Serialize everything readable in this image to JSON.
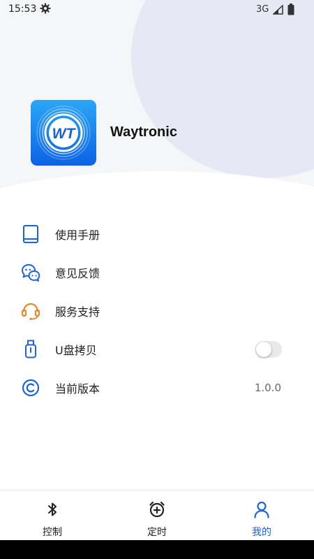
{
  "status_bar": {
    "time": "15:53",
    "network": "3G",
    "gear_icon": "gear-icon",
    "signal_icon": "signal-icon",
    "battery_icon": "battery-icon"
  },
  "app": {
    "name": "Waytronic",
    "logo_text": "WT"
  },
  "menu": {
    "items": [
      {
        "label": "使用手册",
        "icon": "book-icon",
        "color": "#1e63d6"
      },
      {
        "label": "意见反馈",
        "icon": "chat-bubbles-icon",
        "color": "#1e63d6"
      },
      {
        "label": "服务支持",
        "icon": "headset-icon",
        "color": "#e8892d"
      },
      {
        "label": "U盘拷贝",
        "icon": "usb-drive-icon",
        "color": "#1e63d6",
        "toggle_on": false
      },
      {
        "label": "当前版本",
        "icon": "copyright-icon",
        "color": "#1e63d6",
        "value": "1.0.0"
      }
    ]
  },
  "tabs": [
    {
      "label": "控制",
      "icon": "bluetooth-icon",
      "active": false
    },
    {
      "label": "定时",
      "icon": "alarm-clock-icon",
      "active": false
    },
    {
      "label": "我的",
      "icon": "person-icon",
      "active": true
    }
  ],
  "colors": {
    "accent": "#1e63d6",
    "orange": "#e8892d",
    "header_bg": "#f5f6f8",
    "blob": "#e6e9f4"
  }
}
